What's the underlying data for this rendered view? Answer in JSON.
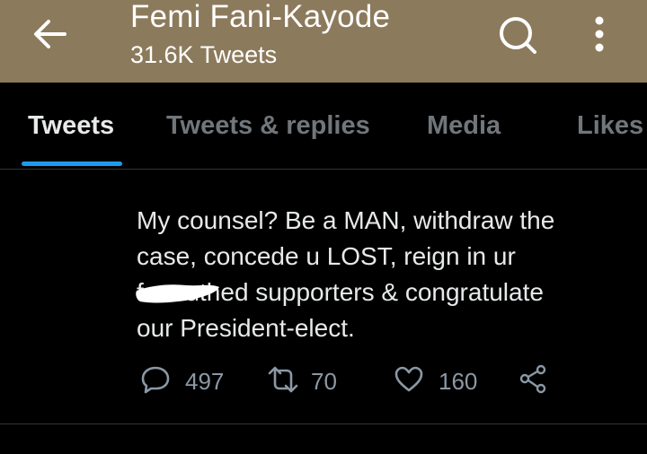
{
  "header": {
    "title": "Femi Fani-Kayode",
    "tweet_count": "31.6K Tweets",
    "back_icon": "arrow-left-icon",
    "search_icon": "search-icon",
    "more_icon": "more-vertical-icon",
    "background_color": "#8c7a5c"
  },
  "tabs": [
    {
      "label": "Tweets",
      "active": true
    },
    {
      "label": "Tweets & replies",
      "active": false
    },
    {
      "label": "Media",
      "active": false
    },
    {
      "label": "Likes",
      "active": false
    }
  ],
  "tweet": {
    "lines": [
      "My counsel? Be a MAN, withdraw the",
      "case, concede u LOST, reign in ur",
      "f     mouthed supporters & congratulate",
      "our President-elect."
    ],
    "actions": {
      "replies": "497",
      "retweets": "70",
      "likes": "160"
    }
  },
  "colors": {
    "accent": "#1d9bf0",
    "muted_text": "#71767b",
    "action_text": "#8b98a5"
  }
}
